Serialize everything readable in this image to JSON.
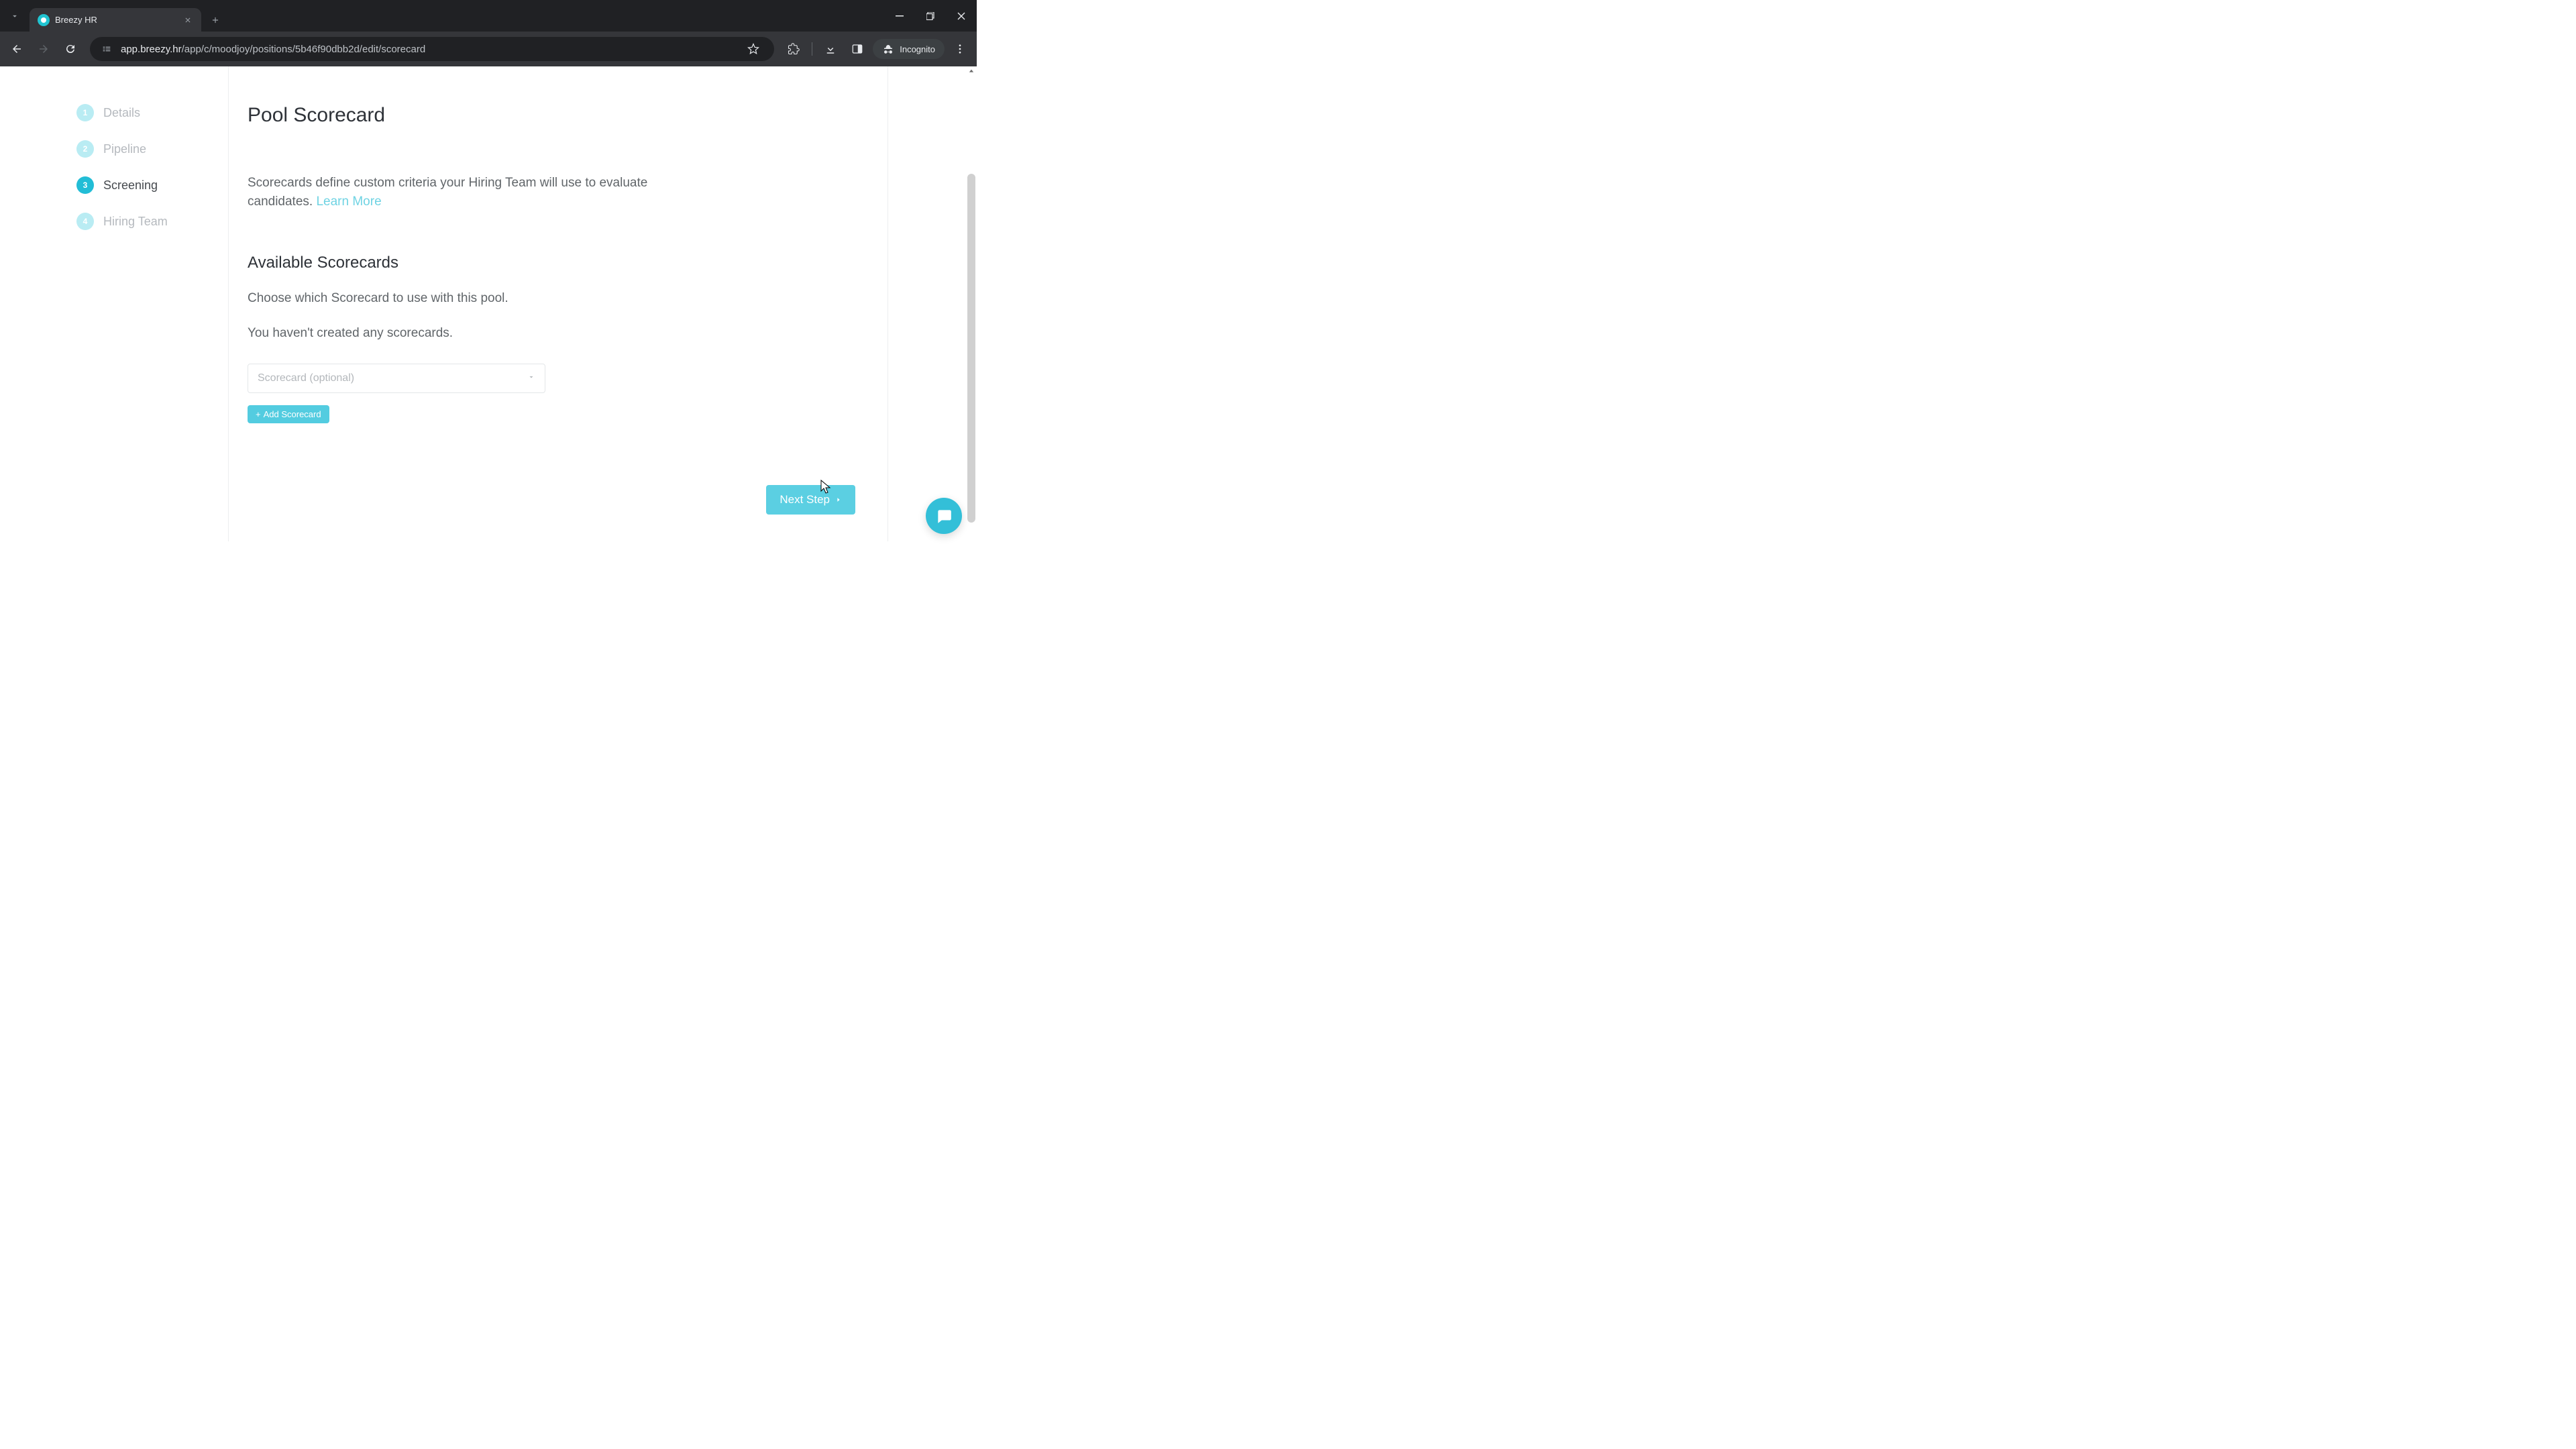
{
  "browser": {
    "tab_title": "Breezy HR",
    "url_host": "app.breezy.hr",
    "url_path": "/app/c/moodjoy/positions/5b46f90dbb2d/edit/scorecard",
    "incognito_label": "Incognito"
  },
  "sidebar": {
    "steps": [
      {
        "num": "1",
        "label": "Details",
        "active": false
      },
      {
        "num": "2",
        "label": "Pipeline",
        "active": false
      },
      {
        "num": "3",
        "label": "Screening",
        "active": true
      },
      {
        "num": "4",
        "label": "Hiring Team",
        "active": false
      }
    ]
  },
  "main": {
    "title": "Pool Scorecard",
    "description_prefix": "Scorecards define custom criteria your Hiring Team will use to evaluate candidates. ",
    "learn_more": "Learn More",
    "section_heading": "Available Scorecards",
    "choose_text": "Choose which Scorecard to use with this pool.",
    "empty_text": "You haven't created any scorecards.",
    "select_placeholder": "Scorecard (optional)",
    "add_button": "Add Scorecard",
    "next_button": "Next Step"
  }
}
